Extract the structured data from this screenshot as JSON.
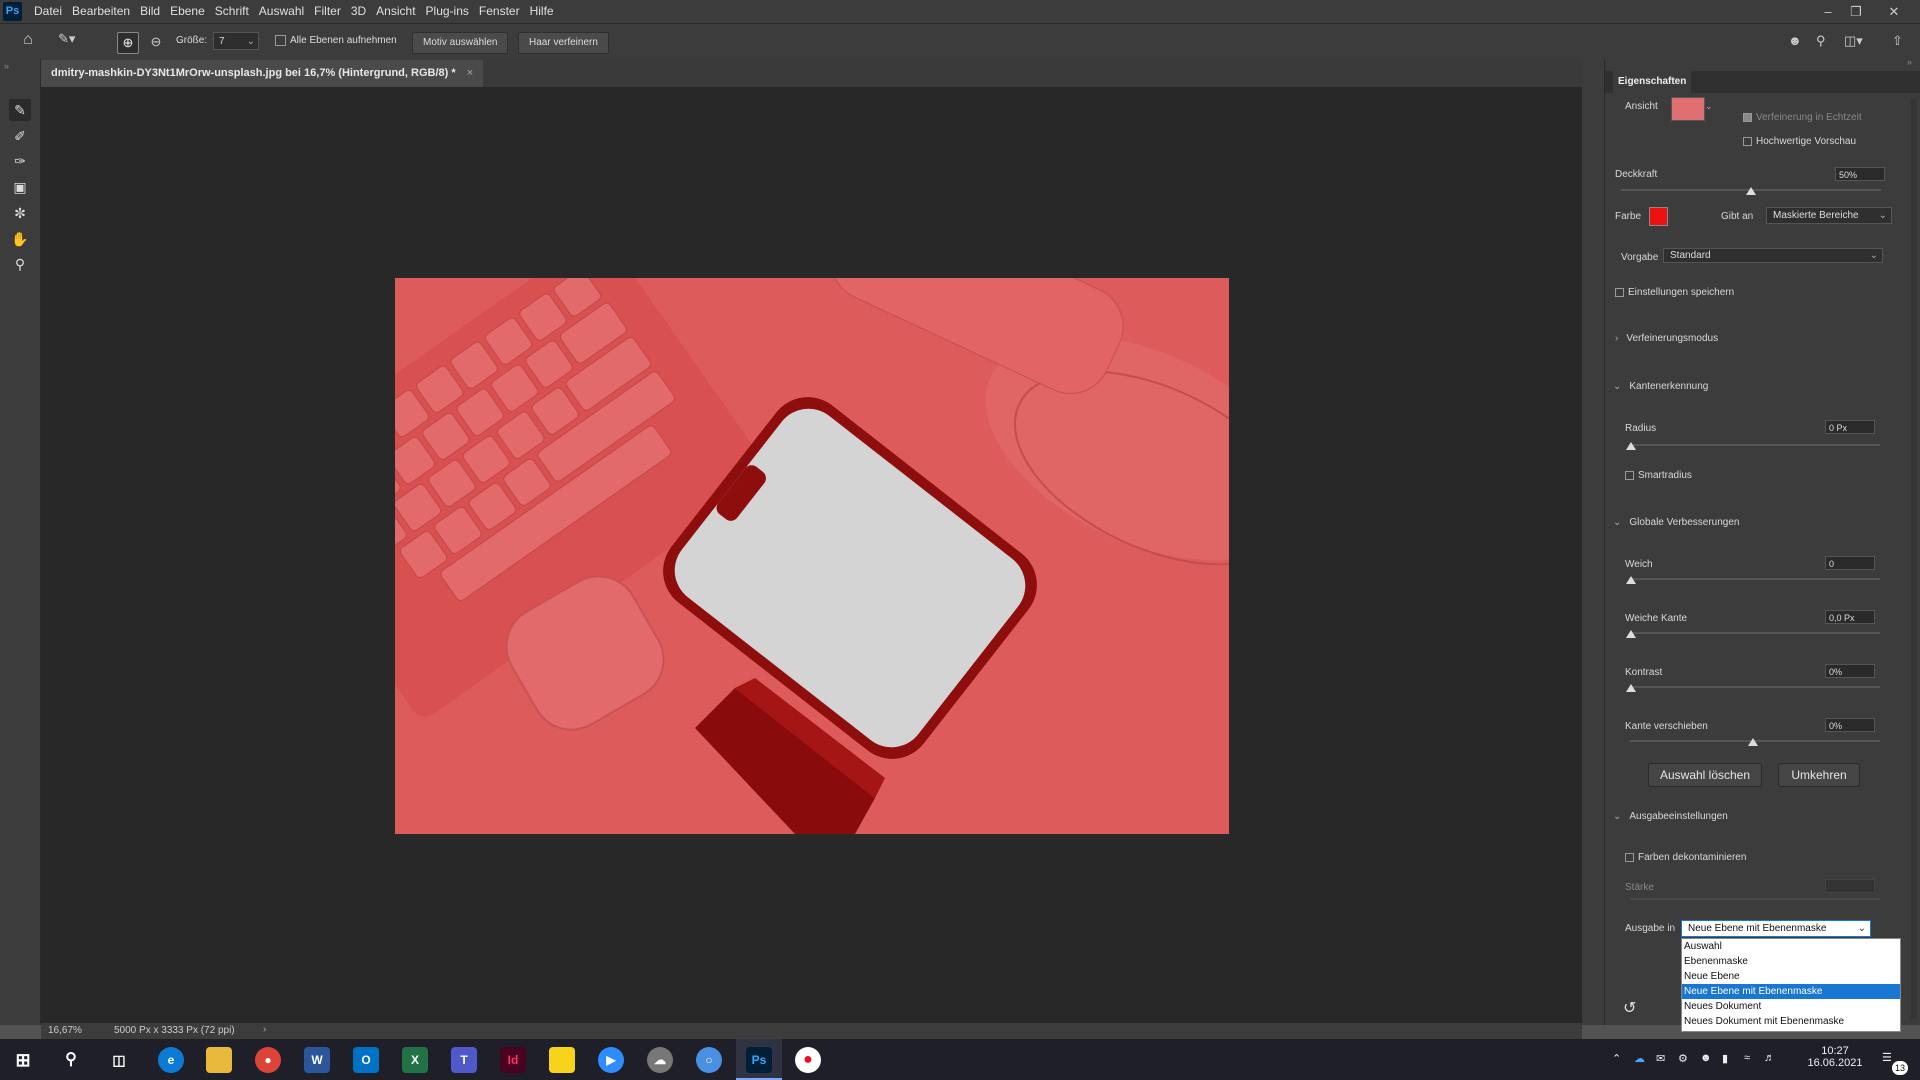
{
  "menubar": {
    "logo": "Ps",
    "items": [
      "Datei",
      "Bearbeiten",
      "Bild",
      "Ebene",
      "Schrift",
      "Auswahl",
      "Filter",
      "3D",
      "Ansicht",
      "Plug-ins",
      "Fenster",
      "Hilfe"
    ]
  },
  "options": {
    "size_label": "Größe:",
    "size_value": "7",
    "all_layers_label": "Alle Ebenen aufnehmen",
    "select_subject": "Motiv auswählen",
    "refine_hair": "Haar verfeinern"
  },
  "document": {
    "tab_title": "dmitry-mashkin-DY3Nt1MrOrw-unsplash.jpg bei 16,7% (Hintergrund, RGB/8) *",
    "zoom": "16,67%",
    "info": "5000 Px x 3333 Px (72 ppi)"
  },
  "panel": {
    "title": "Eigenschaften",
    "view_label": "Ansicht",
    "realtime_label": "Verfeinerung in Echtzeit",
    "hq_preview_label": "Hochwertige Vorschau",
    "opacity_label": "Deckkraft",
    "opacity_value": "50%",
    "opacity_level": 0.5,
    "color_label": "Farbe",
    "color_value": "#ee1111",
    "indicates_label": "Gibt an",
    "indicates_value": "Maskierte Bereiche",
    "preset_label": "Vorgabe",
    "preset_value": "Standard",
    "save_settings_label": "Einstellungen speichern",
    "refine_mode": "Verfeinerungsmodus",
    "edge_detection": "Kantenerkennung",
    "radius_label": "Radius",
    "radius_value": "0 Px",
    "smart_radius_label": "Smartradius",
    "global_refinements": "Globale Verbesserungen",
    "smooth_label": "Weich",
    "smooth_value": "0",
    "feather_label": "Weiche Kante",
    "feather_value": "0,0 Px",
    "contrast_label": "Kontrast",
    "contrast_value": "0%",
    "shift_edge_label": "Kante verschieben",
    "shift_edge_value": "0%",
    "clear_selection": "Auswahl löschen",
    "invert": "Umkehren",
    "output_settings": "Ausgabeeinstellungen",
    "decontaminate_label": "Farben dekontaminieren",
    "amount_label": "Stärke",
    "output_to_label": "Ausgabe in",
    "output_to_value": "Neue Ebene mit Ebenenmaske",
    "output_options": [
      "Auswahl",
      "Ebenenmaske",
      "Neue Ebene",
      "Neue Ebene mit Ebenenmaske",
      "Neues Dokument",
      "Neues Dokument mit Ebenenmaske"
    ],
    "selected_option_index": 3
  },
  "taskbar": {
    "time": "10:27",
    "date": "16.06.2021",
    "notifications": "13",
    "apps": [
      "windows-start",
      "search",
      "task-view",
      "edge",
      "file-explorer",
      "chrome",
      "word",
      "outlook",
      "excel",
      "teams",
      "indesign",
      "sticky-notes",
      "zoom",
      "app-cloud",
      "chat-app",
      "photoshop",
      "screen-recorder"
    ]
  }
}
